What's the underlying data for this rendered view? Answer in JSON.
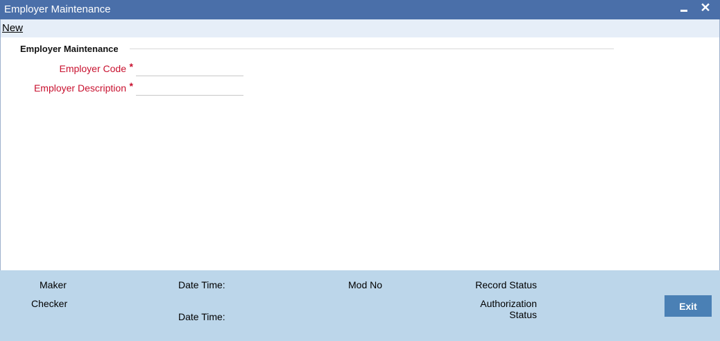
{
  "window": {
    "title": "Employer Maintenance",
    "minimize_icon": "minimize-icon",
    "close_icon": "close-icon",
    "close_glyph": "✕"
  },
  "toolbar": {
    "new_label": "New"
  },
  "section": {
    "title": "Employer Maintenance"
  },
  "form": {
    "employer_code": {
      "label": "Employer Code",
      "required": "*",
      "value": ""
    },
    "employer_description": {
      "label": "Employer Description",
      "required": "*",
      "value": ""
    }
  },
  "footer": {
    "maker_label": "Maker",
    "checker_label": "Checker",
    "maker_datetime_label": "Date Time:",
    "checker_datetime_label": "Date Time:",
    "mod_no_label": "Mod No",
    "record_status_label": "Record Status",
    "authorization_status_label_1": "Authorization",
    "authorization_status_label_2": "Status",
    "exit_label": "Exit"
  },
  "colors": {
    "titlebar": "#4a6fa9",
    "toolbar": "#e6eef8",
    "footer": "#bcd6ea",
    "required_label": "#c8102e",
    "exit_button": "#4a80b5"
  }
}
